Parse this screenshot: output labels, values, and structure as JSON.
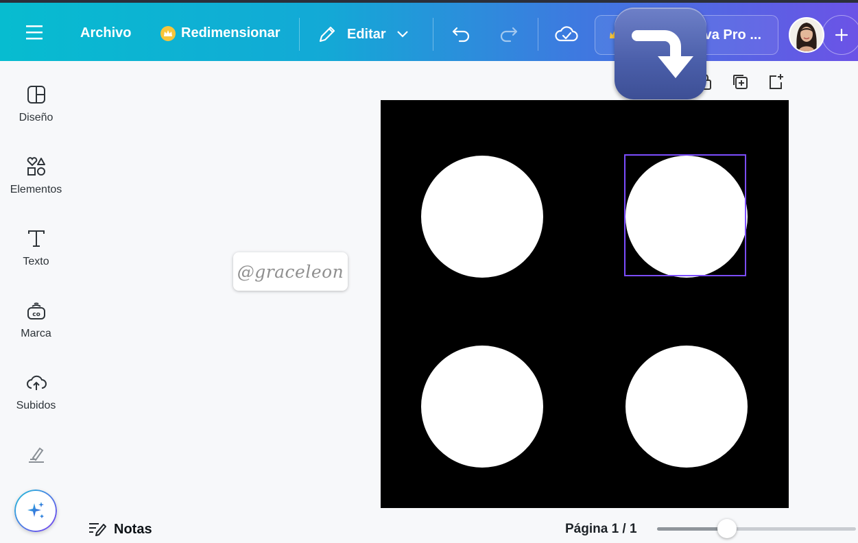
{
  "topbar": {
    "menu_icon": "hamburger-icon",
    "archivo_label": "Archivo",
    "redimensionar_label": "Redimensionar",
    "editar_label": "Editar",
    "undo_icon": "undo-icon",
    "redo_icon": "redo-icon",
    "save_status_icon": "cloud-check-icon",
    "pro_button_label": "va Pro ...",
    "add_icon": "plus-icon"
  },
  "overlay": {
    "icon": "right-arrow-curving-down-icon"
  },
  "sidebar": {
    "items": [
      {
        "label": "Diseño",
        "icon": "layout-icon"
      },
      {
        "label": "Elementos",
        "icon": "shapes-icon"
      },
      {
        "label": "Texto",
        "icon": "text-icon"
      },
      {
        "label": "Marca",
        "icon": "brand-icon"
      },
      {
        "label": "Subidos",
        "icon": "cloud-upload-icon"
      },
      {
        "label": "",
        "icon": "draw-icon"
      }
    ],
    "magic_icon": "sparkle-icon"
  },
  "watermark": {
    "text": "@graceleon"
  },
  "canvas": {
    "background": "#000000",
    "shape_color": "#ffffff",
    "selection_color": "#7c4dff",
    "selected_index": 1
  },
  "footer": {
    "notes_label": "Notas",
    "page_indicator": "Página 1 / 1",
    "zoom_fraction": 0.35
  },
  "colors": {
    "accent": "#7c4dff",
    "gradient_start": "#07bcd0",
    "gradient_end": "#6b53e6"
  }
}
